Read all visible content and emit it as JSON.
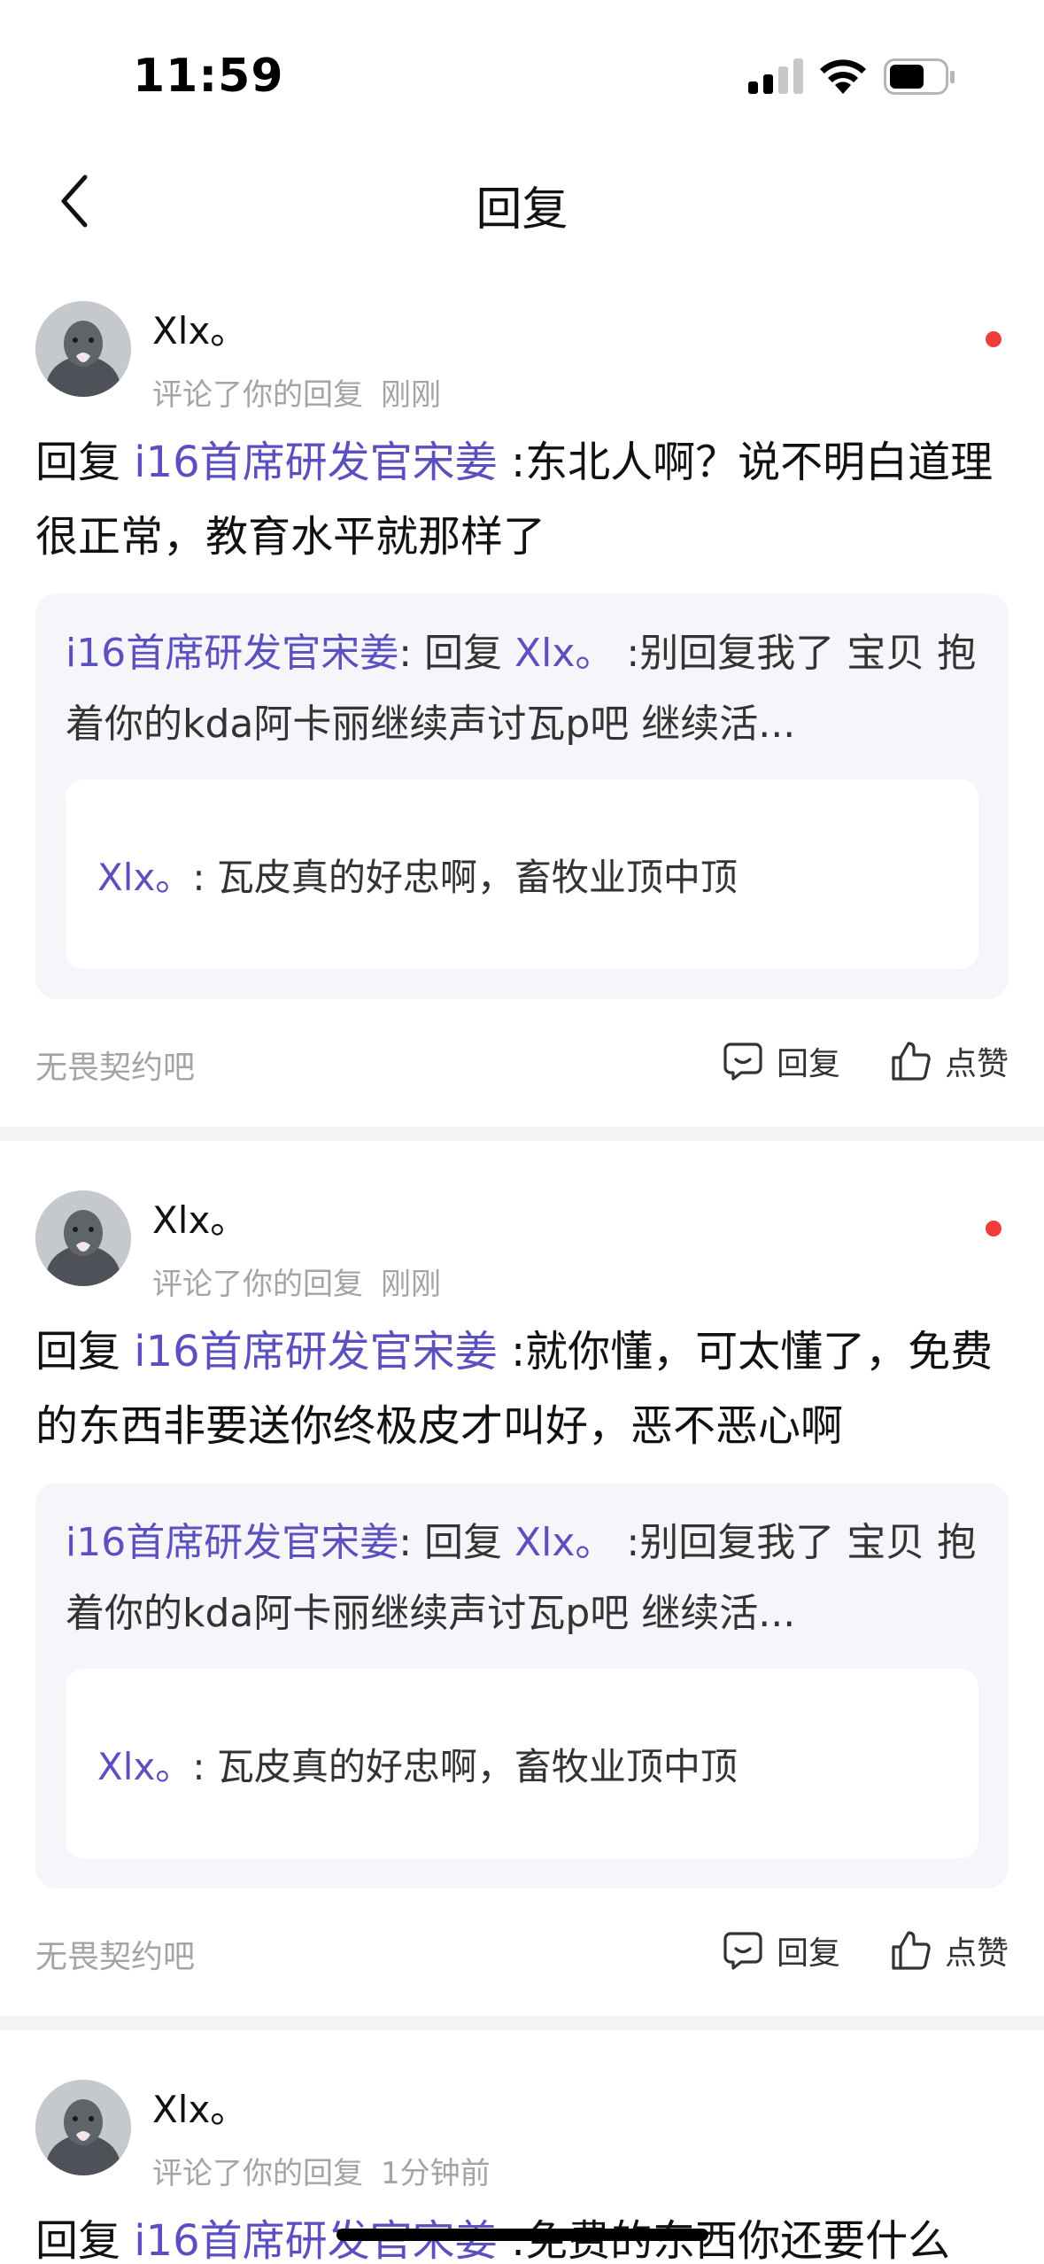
{
  "status": {
    "time": "11:59"
  },
  "nav": {
    "title": "回复"
  },
  "cards": [
    {
      "user": "Xlx。",
      "action_text": "评论了你的回复",
      "time": "刚刚",
      "reply_prefix": "回复 ",
      "reply_mention": "i16首席研发官宋姜",
      "reply_body": " :东北人啊？说不明白道理很正常，教育水平就那样了",
      "quote_author": "i16首席研发官宋姜",
      "quote_mid": ": 回复 ",
      "quote_mention": "Xlx。",
      "quote_body": " :别回复我了 宝贝 抱着你的kda阿卡丽继续声讨瓦p吧 继续活...",
      "nested_author": "Xlx。",
      "nested_body": ": 瓦皮真的好忠啊，畜牧业顶中顶",
      "forum": "无畏契约吧",
      "reply_label": "回复",
      "like_label": "点赞"
    },
    {
      "user": "Xlx。",
      "action_text": "评论了你的回复",
      "time": "刚刚",
      "reply_prefix": "回复 ",
      "reply_mention": "i16首席研发官宋姜",
      "reply_body": " :就你懂，可太懂了，免费的东西非要送你终极皮才叫好，恶不恶心啊",
      "quote_author": "i16首席研发官宋姜",
      "quote_mid": ": 回复 ",
      "quote_mention": "Xlx。",
      "quote_body": " :别回复我了 宝贝 抱着你的kda阿卡丽继续声讨瓦p吧 继续活...",
      "nested_author": "Xlx。",
      "nested_body": ": 瓦皮真的好忠啊，畜牧业顶中顶",
      "forum": "无畏契约吧",
      "reply_label": "回复",
      "like_label": "点赞"
    },
    {
      "user": "Xlx。",
      "action_text": "评论了你的回复",
      "time": "1分钟前",
      "reply_prefix": "回复 ",
      "reply_mention": "i16首席研发官宋姜",
      "reply_body": " :免费的东西你还要什么"
    }
  ],
  "colors": {
    "mention": "#5c4fc0",
    "unread_dot": "#f23c3c",
    "quote_bg": "#f5f5fa"
  },
  "icons": {
    "back": "chevron-left-icon",
    "reply": "comment-icon",
    "like": "thumbs-up-icon"
  }
}
